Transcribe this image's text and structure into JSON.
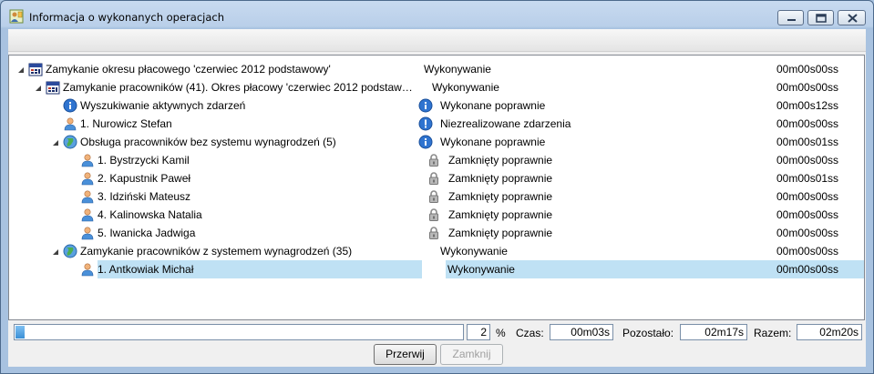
{
  "window": {
    "title": "Informacja o wykonanych operacjach"
  },
  "tree": {
    "rows": [
      {
        "label": "Zamykanie okresu płacowego 'czerwiec 2012 podstawowy'",
        "status": "Wykonywanie",
        "time": "00m00s00ss",
        "icon": "calendar-icon",
        "status_icon": ""
      },
      {
        "label": "Zamykanie pracowników (41). Okres płacowy 'czerwiec 2012 podstaw…",
        "status": "Wykonywanie",
        "time": "00m00s00ss",
        "icon": "calendar-icon",
        "status_icon": ""
      },
      {
        "label": "Wyszukiwanie aktywnych zdarzeń",
        "status": "Wykonane poprawnie",
        "time": "00m00s12ss",
        "icon": "info-icon",
        "status_icon": "info-icon"
      },
      {
        "label": "1. Nurowicz Stefan",
        "status": "Niezrealizowane zdarzenia",
        "time": "00m00s00ss",
        "icon": "person-icon",
        "status_icon": "warning-icon"
      },
      {
        "label": "Obsługa pracowników bez systemu wynagrodzeń (5)",
        "status": "Wykonane poprawnie",
        "time": "00m00s01ss",
        "icon": "globe-icon",
        "status_icon": "info-icon"
      },
      {
        "label": "1. Bystrzycki Kamil",
        "status": "Zamknięty poprawnie",
        "time": "00m00s00ss",
        "icon": "person-icon",
        "status_icon": "lock-icon"
      },
      {
        "label": "2. Kapustnik Paweł",
        "status": "Zamknięty poprawnie",
        "time": "00m00s01ss",
        "icon": "person-icon",
        "status_icon": "lock-icon"
      },
      {
        "label": "3. Idziński Mateusz",
        "status": "Zamknięty poprawnie",
        "time": "00m00s00ss",
        "icon": "person-icon",
        "status_icon": "lock-icon"
      },
      {
        "label": "4. Kalinowska Natalia",
        "status": "Zamknięty poprawnie",
        "time": "00m00s00ss",
        "icon": "person-icon",
        "status_icon": "lock-icon"
      },
      {
        "label": "5. Iwanicka Jadwiga",
        "status": "Zamknięty poprawnie",
        "time": "00m00s00ss",
        "icon": "person-icon",
        "status_icon": "lock-icon"
      },
      {
        "label": "Zamykanie pracowników z systemem wynagrodzeń (35)",
        "status": "Wykonywanie",
        "time": "00m00s00ss",
        "icon": "globe-icon",
        "status_icon": ""
      },
      {
        "label": "1. Antkowiak Michał",
        "status": "Wykonywanie",
        "time": "00m00s00ss",
        "icon": "person-icon",
        "status_icon": "",
        "selected": true
      }
    ]
  },
  "status_bar": {
    "progress_percent": 2,
    "progress_text": "2",
    "percent_sign": "%",
    "time_label": "Czas:",
    "time_value": "00m03s",
    "remaining_label": "Pozostało:",
    "remaining_value": "02m17s",
    "total_label": "Razem:",
    "total_value": "02m20s"
  },
  "buttons": {
    "interrupt_label": "Przerwij",
    "close_label": "Zamknij"
  },
  "colors": {
    "selection": "#bfe1f4",
    "title_bar": "#b9cfe9"
  }
}
